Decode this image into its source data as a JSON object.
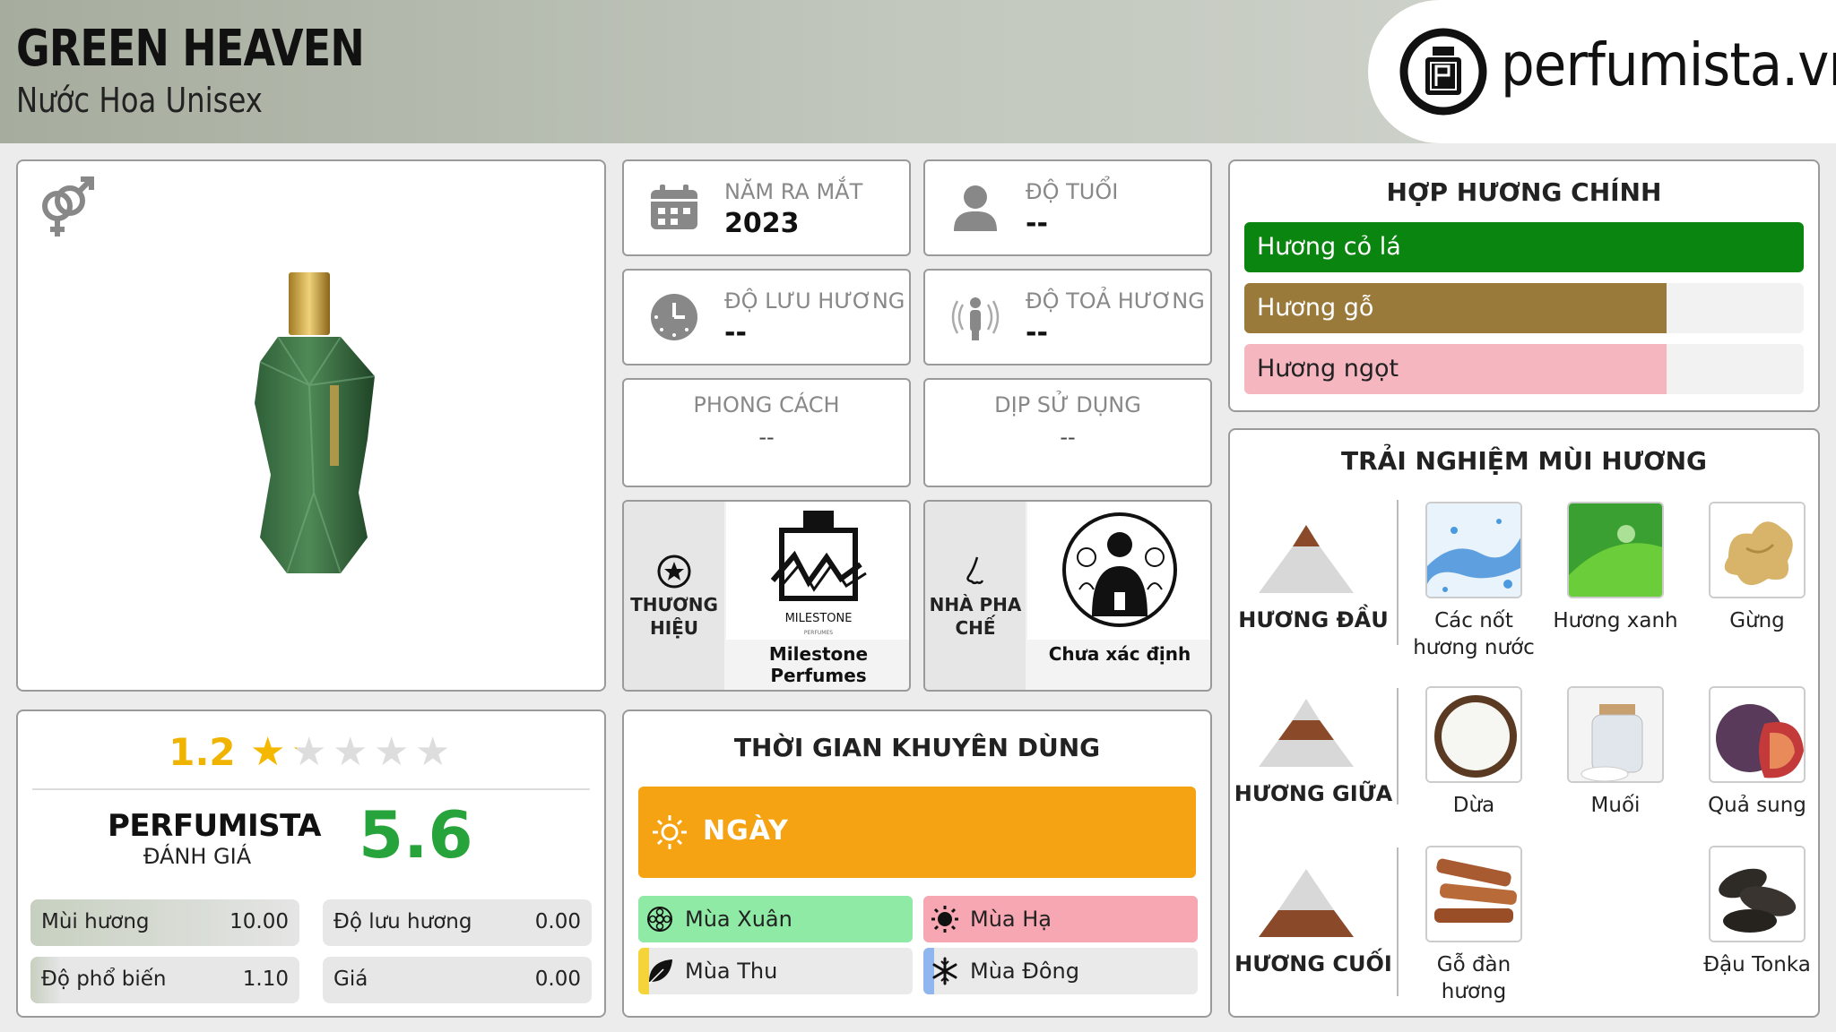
{
  "header": {
    "title": "GREEN HEAVEN",
    "subtitle": "Nước Hoa Unisex",
    "logo_text": "perfumista.vn"
  },
  "info_cards": {
    "launch_year": {
      "label": "NĂM RA MẮT",
      "value": "2023",
      "icon": "calendar-icon"
    },
    "age": {
      "label": "ĐỘ TUỔI",
      "value": "--",
      "icon": "person-icon"
    },
    "longevity": {
      "label": "ĐỘ LƯU HƯƠNG",
      "value": "--",
      "icon": "clock-icon"
    },
    "sillage": {
      "label": "ĐỘ TOẢ HƯƠNG",
      "value": "--",
      "icon": "sillage-icon"
    },
    "style": {
      "label": "PHONG CÁCH",
      "value": "--"
    },
    "occasion": {
      "label": "DỊP SỬ DỤNG",
      "value": "--"
    }
  },
  "brand": {
    "label": "THƯƠNG HIỆU",
    "name": "Milestone Perfumes",
    "logo_lines": [
      "MILESTONE",
      "PERFUMES"
    ]
  },
  "perfumer": {
    "label": "NHÀ PHA CHẾ",
    "name": "Chưa xác định"
  },
  "rating": {
    "user_score": "1.2",
    "stars_total": 5,
    "stars_value": 1.2,
    "pf_label": "PERFUMISTA",
    "pf_sub": "ĐÁNH GIÁ",
    "pf_score": "5.6",
    "metrics": [
      {
        "label": "Mùi hương",
        "value": "10.00",
        "fraction": 1.0
      },
      {
        "label": "Độ lưu hương",
        "value": "0.00",
        "fraction": 0.0
      },
      {
        "label": "Độ phổ biến",
        "value": "1.10",
        "fraction": 0.11
      },
      {
        "label": "Giá",
        "value": "0.00",
        "fraction": 0.0
      }
    ]
  },
  "time": {
    "title": "THỜI GIAN KHUYÊN DÙNG",
    "day_label": "NGÀY",
    "day_color": "#f5a313",
    "seasons": [
      {
        "label": "Mùa Xuân",
        "fraction": 1.0,
        "color": "#8eeaa5",
        "icon": "spring-flower-icon"
      },
      {
        "label": "Mùa Hạ",
        "fraction": 1.0,
        "color": "#f7a7b1",
        "icon": "sun-icon"
      },
      {
        "label": "Mùa Thu",
        "fraction": 0.04,
        "color": "#f5d43a",
        "icon": "leaf-icon"
      },
      {
        "label": "Mùa Đông",
        "fraction": 0.04,
        "color": "#8fb6ef",
        "icon": "snowflake-icon"
      }
    ]
  },
  "accords": {
    "title": "HỢP HƯƠNG CHÍNH",
    "items": [
      {
        "label": "Hương cỏ lá",
        "fraction": 1.0,
        "color": "#0a850f"
      },
      {
        "label": "Hương gỗ",
        "fraction": 0.755,
        "color": "#9a7a3a"
      },
      {
        "label": "Hương ngọt",
        "fraction": 0.755,
        "color": "#f6b6c0"
      }
    ]
  },
  "notes": {
    "title": "TRẢI NGHIỆM MÙI HƯƠNG",
    "tiers": [
      {
        "label": "HƯƠNG ĐẦU",
        "items": [
          "Các nốt hương nước",
          "Hương xanh",
          "Gừng"
        ]
      },
      {
        "label": "HƯƠNG GIỮA",
        "items": [
          "Dừa",
          "Muối",
          "Quả sung"
        ]
      },
      {
        "label": "HƯƠNG CUỐI",
        "items": [
          "Gỗ đàn hương",
          "Đậu Tonka"
        ]
      }
    ]
  }
}
